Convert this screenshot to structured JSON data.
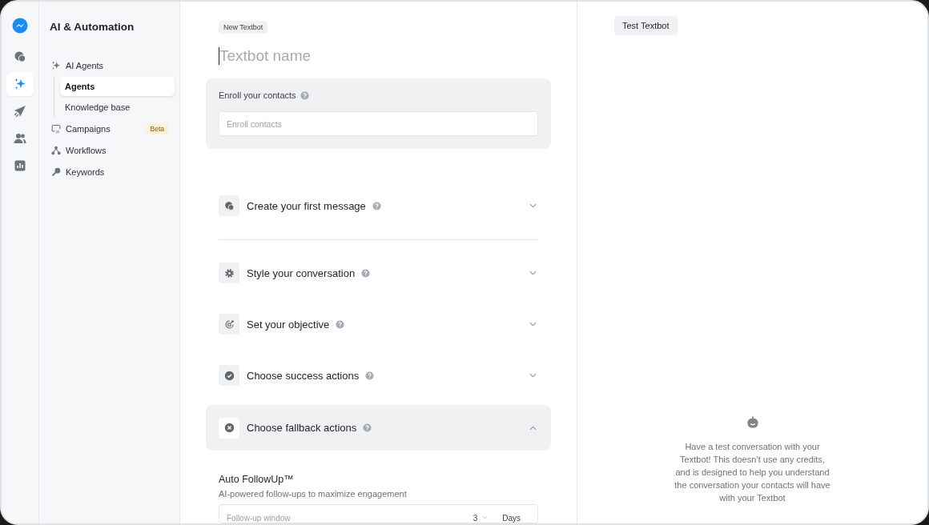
{
  "rail": [
    {
      "selected": false
    },
    {
      "selected": true
    },
    {
      "selected": false
    },
    {
      "selected": false
    },
    {
      "selected": false
    }
  ],
  "sidebar": {
    "title": "AI & Automation",
    "items": [
      {
        "label": "AI Agents",
        "selected": false,
        "expanded": true,
        "children": [
          {
            "label": "Agents",
            "selected": true
          },
          {
            "label": "Knowledge base",
            "selected": false
          }
        ]
      },
      {
        "label": "Campaigns",
        "selected": false,
        "badge": "Beta"
      },
      {
        "label": "Workflows",
        "selected": false
      },
      {
        "label": "Keywords",
        "selected": false
      }
    ]
  },
  "editor": {
    "tag": "New Textbot",
    "name_field": {
      "placeholder": "Textbot name"
    },
    "enroll": {
      "label": "Enroll your contacts",
      "field": {
        "placeholder": "Enroll contacts"
      }
    },
    "sections": [
      {
        "title": "Create your first message",
        "expanded": false
      },
      {
        "title": "Style your conversation",
        "expanded": false
      },
      {
        "title": "Set your objective",
        "expanded": false
      },
      {
        "title": "Choose success actions",
        "expanded": false
      },
      {
        "title": "Choose fallback actions",
        "expanded": true
      }
    ],
    "followup": {
      "title": "Auto FollowUp™",
      "subtitle": "AI-powered follow-ups to maximize engagement",
      "field_label": "Follow-up window",
      "amount": "3",
      "unit": "Days"
    }
  },
  "preview": {
    "button": "Test Textbot",
    "message": "Have a test conversation with your Textbot! This doesn’t use any credits, and is designed to help you understand the conversation your contacts will have with your Textbot"
  }
}
